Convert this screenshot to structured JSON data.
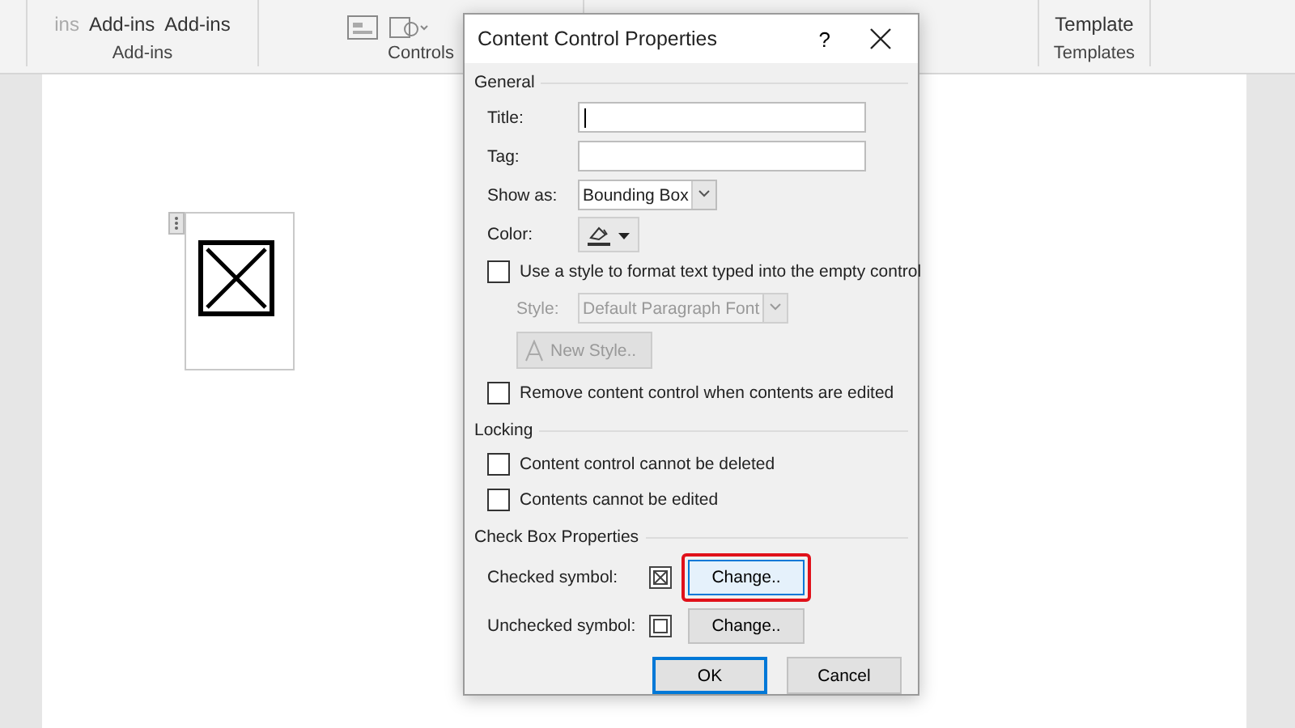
{
  "ribbon": {
    "groups": [
      {
        "label": "Add-ins",
        "buttons": [
          "ins",
          "Add-ins",
          "Add-ins"
        ]
      },
      {
        "label": "Controls"
      },
      {
        "label": "Templates",
        "buttons": [
          "Template"
        ]
      }
    ]
  },
  "document": {
    "control": {
      "checked": true
    }
  },
  "dialog": {
    "title": "Content Control Properties",
    "help": "?",
    "general": {
      "heading": "General",
      "title_label": "Title:",
      "tag_label": "Tag:",
      "show_as_label": "Show as:",
      "show_as_value": "Bounding Box",
      "color_label": "Color:",
      "use_style": {
        "label": "Use a style to format text typed into the empty control",
        "checked": false
      },
      "style_label": "Style:",
      "style_value": "Default Paragraph Font",
      "style_disabled": true,
      "new_style": "New Style..",
      "remove": {
        "label": "Remove content control when contents are edited",
        "checked": false
      }
    },
    "locking": {
      "heading": "Locking",
      "options": [
        {
          "label": "Content control cannot be deleted",
          "checked": false
        },
        {
          "label": "Contents cannot be edited",
          "checked": false
        }
      ]
    },
    "checkbox_properties": {
      "heading": "Check Box Properties",
      "rows": [
        {
          "label": "Checked symbol:",
          "kind": "checked",
          "button": "Change..",
          "highlighted": true
        },
        {
          "label": "Unchecked symbol:",
          "kind": "unchecked",
          "button": "Change..",
          "highlighted": false
        }
      ]
    },
    "buttons": [
      {
        "label": "OK",
        "selected": true
      },
      {
        "label": "Cancel",
        "selected": false
      }
    ]
  }
}
